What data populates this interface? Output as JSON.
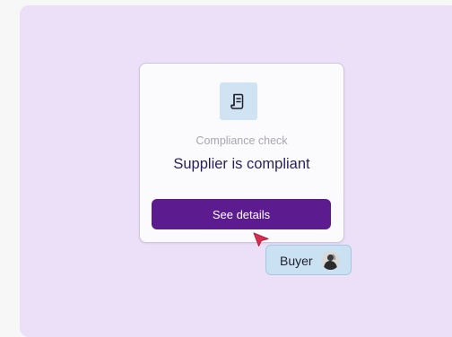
{
  "card": {
    "icon": "receipt-icon",
    "subtitle": "Compliance check",
    "title": "Supplier is compliant",
    "button_label": "See details"
  },
  "cursor": {
    "icon": "cursor-pointer-icon",
    "user_label": "Buyer",
    "avatar": "avatar-icon"
  },
  "colors": {
    "stage_background": "#ecdff8",
    "card_background": "#fbfbfd",
    "icon_tile": "#cfe3f3",
    "button": "#5c1c8f",
    "title_text": "#2a1f5a",
    "subtitle_text": "#a9a6b0",
    "cursor": "#d62f4f",
    "buyer_tag": "#c9e1f2"
  }
}
